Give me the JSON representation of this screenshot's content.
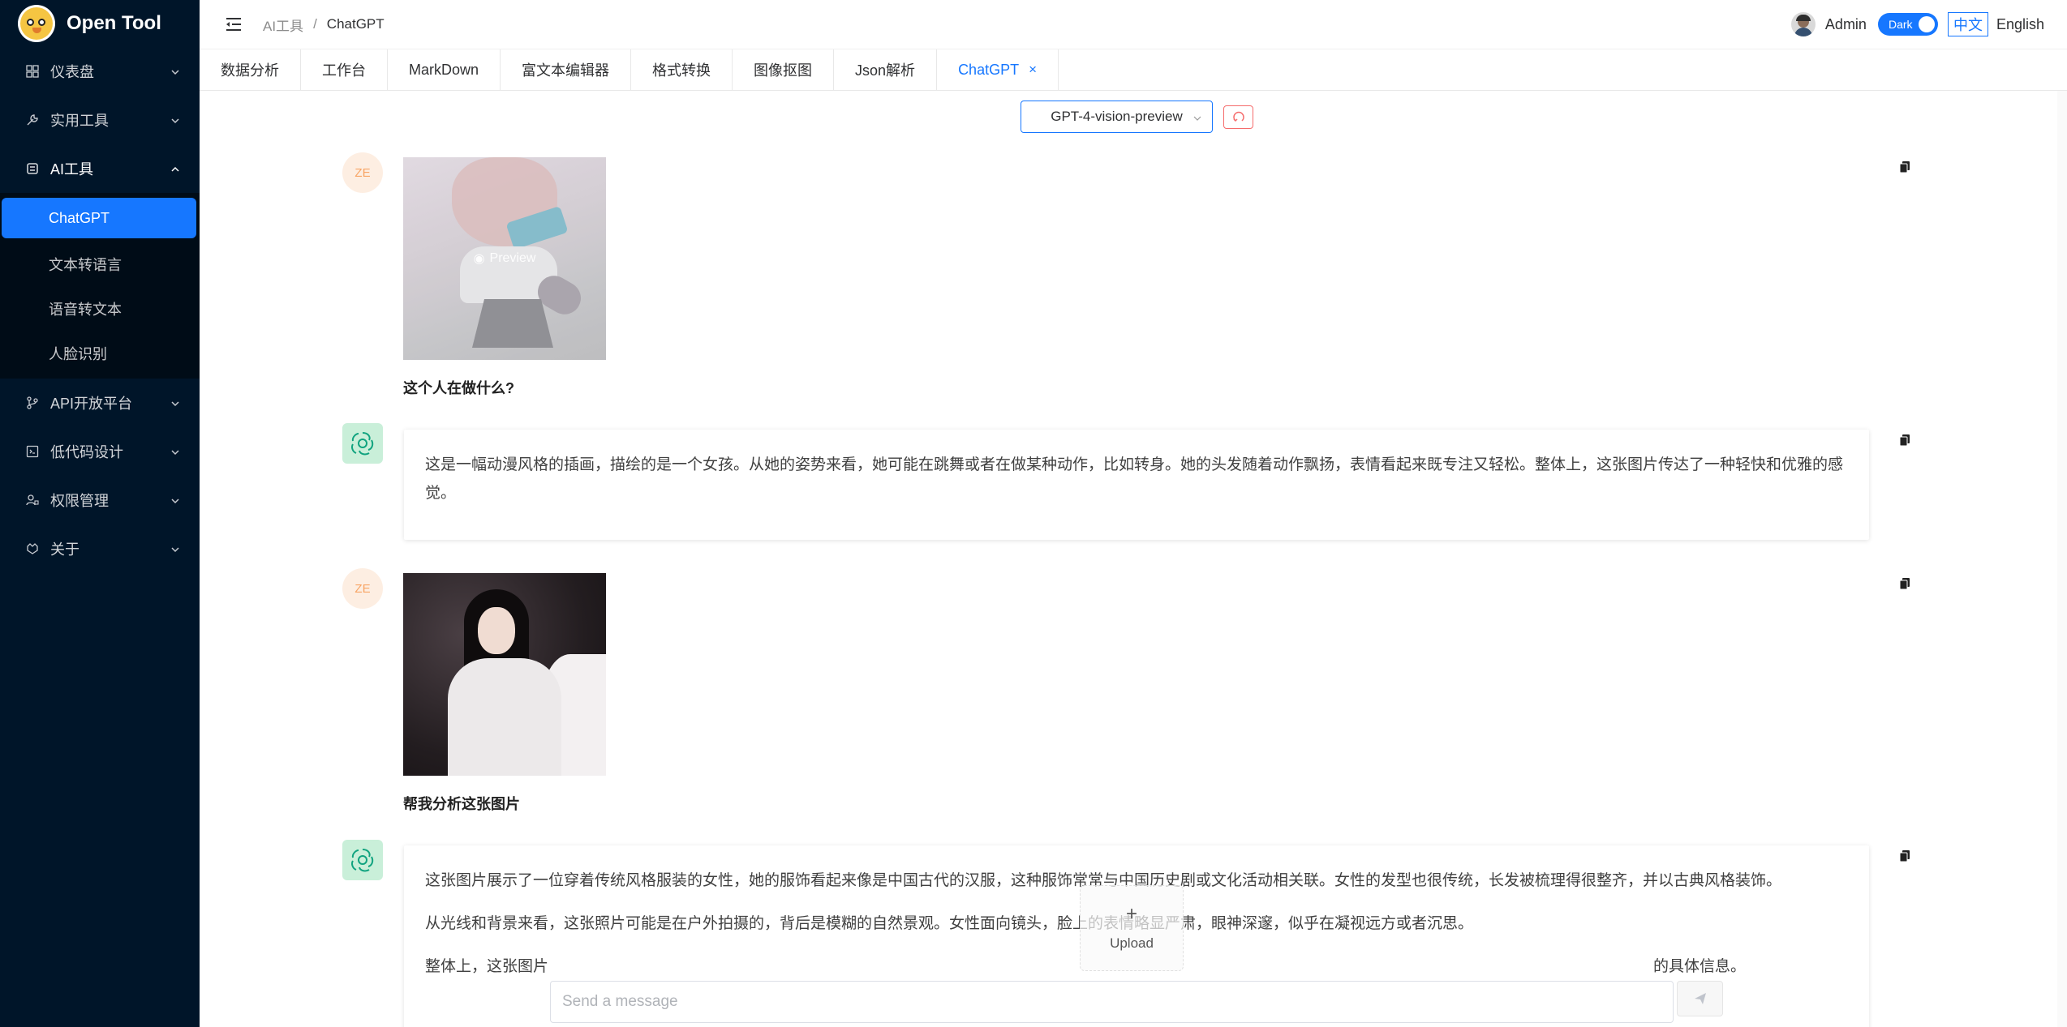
{
  "app": {
    "title": "Open Tool"
  },
  "sidebar": {
    "items": [
      {
        "label": "仪表盘",
        "icon": "dashboard-icon",
        "expanded": false
      },
      {
        "label": "实用工具",
        "icon": "tool-icon",
        "expanded": false
      },
      {
        "label": "AI工具",
        "icon": "robot-icon",
        "expanded": true
      },
      {
        "label": "API开放平台",
        "icon": "api-icon",
        "expanded": false
      },
      {
        "label": "低代码设计",
        "icon": "code-icon",
        "expanded": false
      },
      {
        "label": "权限管理",
        "icon": "user-lock-icon",
        "expanded": false
      },
      {
        "label": "关于",
        "icon": "about-icon",
        "expanded": false
      }
    ],
    "ai_submenu": [
      {
        "label": "ChatGPT",
        "active": true
      },
      {
        "label": "文本转语言",
        "active": false
      },
      {
        "label": "语音转文本",
        "active": false
      },
      {
        "label": "人脸识别",
        "active": false
      }
    ]
  },
  "header": {
    "breadcrumb": {
      "parent": "AI工具",
      "separator": "/",
      "current": "ChatGPT"
    },
    "user": "Admin",
    "theme_toggle_label": "Dark",
    "lang_zh": "中文",
    "lang_en": "English"
  },
  "tabs": [
    {
      "label": "数据分析"
    },
    {
      "label": "工作台"
    },
    {
      "label": "MarkDown"
    },
    {
      "label": "富文本编辑器"
    },
    {
      "label": "格式转换"
    },
    {
      "label": "图像抠图"
    },
    {
      "label": "Json解析"
    },
    {
      "label": "ChatGPT",
      "active": true,
      "close": "×"
    }
  ],
  "chat": {
    "model_select": "GPT-4-vision-preview",
    "user_initials": "ZE",
    "preview_label": "Preview",
    "messages": [
      {
        "role": "user",
        "caption": "这个人在做什么?"
      },
      {
        "role": "assistant",
        "paragraphs": [
          "这是一幅动漫风格的插画，描绘的是一个女孩。从她的姿势来看，她可能在跳舞或者在做某种动作，比如转身。她的头发随着动作飘扬，表情看起来既专注又轻松。整体上，这张图片传达了一种轻快和优雅的感觉。"
        ]
      },
      {
        "role": "user",
        "caption": "帮我分析这张图片"
      },
      {
        "role": "assistant",
        "paragraphs": [
          "这张图片展示了一位穿着传统风格服装的女性，她的服饰看起来像是中国古代的汉服，这种服饰常常与中国历史剧或文化活动相关联。女性的发型也很传统，长发被梳理得很整齐，并以古典风格装饰。",
          "从光线和背景来看，这张照片可能是在户外拍摄的，背后是模糊的自然景观。女性面向镜头，脸上的表情略显严肃，眼神深邃，似乎在凝视远方或者沉思。",
          "整体上，这张图片"
        ],
        "tail_visible": "的具体信息。"
      }
    ],
    "upload_label": "Upload",
    "upload_plus": "+",
    "input_placeholder": "Send a message"
  },
  "colors": {
    "sidebar_bg": "#001529",
    "accent": "#1677ff",
    "bot_icon_bg": "#c9efd9",
    "user_avatar_bg": "#fde3cf"
  }
}
